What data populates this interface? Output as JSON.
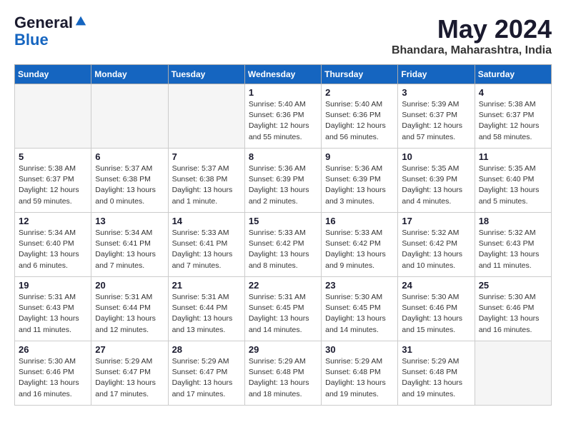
{
  "header": {
    "logo_line1": "General",
    "logo_line2": "Blue",
    "month_year": "May 2024",
    "location": "Bhandara, Maharashtra, India"
  },
  "weekdays": [
    "Sunday",
    "Monday",
    "Tuesday",
    "Wednesday",
    "Thursday",
    "Friday",
    "Saturday"
  ],
  "weeks": [
    [
      {
        "day": "",
        "info": ""
      },
      {
        "day": "",
        "info": ""
      },
      {
        "day": "",
        "info": ""
      },
      {
        "day": "1",
        "info": "Sunrise: 5:40 AM\nSunset: 6:36 PM\nDaylight: 12 hours\nand 55 minutes."
      },
      {
        "day": "2",
        "info": "Sunrise: 5:40 AM\nSunset: 6:36 PM\nDaylight: 12 hours\nand 56 minutes."
      },
      {
        "day": "3",
        "info": "Sunrise: 5:39 AM\nSunset: 6:37 PM\nDaylight: 12 hours\nand 57 minutes."
      },
      {
        "day": "4",
        "info": "Sunrise: 5:38 AM\nSunset: 6:37 PM\nDaylight: 12 hours\nand 58 minutes."
      }
    ],
    [
      {
        "day": "5",
        "info": "Sunrise: 5:38 AM\nSunset: 6:37 PM\nDaylight: 12 hours\nand 59 minutes."
      },
      {
        "day": "6",
        "info": "Sunrise: 5:37 AM\nSunset: 6:38 PM\nDaylight: 13 hours\nand 0 minutes."
      },
      {
        "day": "7",
        "info": "Sunrise: 5:37 AM\nSunset: 6:38 PM\nDaylight: 13 hours\nand 1 minute."
      },
      {
        "day": "8",
        "info": "Sunrise: 5:36 AM\nSunset: 6:39 PM\nDaylight: 13 hours\nand 2 minutes."
      },
      {
        "day": "9",
        "info": "Sunrise: 5:36 AM\nSunset: 6:39 PM\nDaylight: 13 hours\nand 3 minutes."
      },
      {
        "day": "10",
        "info": "Sunrise: 5:35 AM\nSunset: 6:39 PM\nDaylight: 13 hours\nand 4 minutes."
      },
      {
        "day": "11",
        "info": "Sunrise: 5:35 AM\nSunset: 6:40 PM\nDaylight: 13 hours\nand 5 minutes."
      }
    ],
    [
      {
        "day": "12",
        "info": "Sunrise: 5:34 AM\nSunset: 6:40 PM\nDaylight: 13 hours\nand 6 minutes."
      },
      {
        "day": "13",
        "info": "Sunrise: 5:34 AM\nSunset: 6:41 PM\nDaylight: 13 hours\nand 7 minutes."
      },
      {
        "day": "14",
        "info": "Sunrise: 5:33 AM\nSunset: 6:41 PM\nDaylight: 13 hours\nand 7 minutes."
      },
      {
        "day": "15",
        "info": "Sunrise: 5:33 AM\nSunset: 6:42 PM\nDaylight: 13 hours\nand 8 minutes."
      },
      {
        "day": "16",
        "info": "Sunrise: 5:33 AM\nSunset: 6:42 PM\nDaylight: 13 hours\nand 9 minutes."
      },
      {
        "day": "17",
        "info": "Sunrise: 5:32 AM\nSunset: 6:42 PM\nDaylight: 13 hours\nand 10 minutes."
      },
      {
        "day": "18",
        "info": "Sunrise: 5:32 AM\nSunset: 6:43 PM\nDaylight: 13 hours\nand 11 minutes."
      }
    ],
    [
      {
        "day": "19",
        "info": "Sunrise: 5:31 AM\nSunset: 6:43 PM\nDaylight: 13 hours\nand 11 minutes."
      },
      {
        "day": "20",
        "info": "Sunrise: 5:31 AM\nSunset: 6:44 PM\nDaylight: 13 hours\nand 12 minutes."
      },
      {
        "day": "21",
        "info": "Sunrise: 5:31 AM\nSunset: 6:44 PM\nDaylight: 13 hours\nand 13 minutes."
      },
      {
        "day": "22",
        "info": "Sunrise: 5:31 AM\nSunset: 6:45 PM\nDaylight: 13 hours\nand 14 minutes."
      },
      {
        "day": "23",
        "info": "Sunrise: 5:30 AM\nSunset: 6:45 PM\nDaylight: 13 hours\nand 14 minutes."
      },
      {
        "day": "24",
        "info": "Sunrise: 5:30 AM\nSunset: 6:46 PM\nDaylight: 13 hours\nand 15 minutes."
      },
      {
        "day": "25",
        "info": "Sunrise: 5:30 AM\nSunset: 6:46 PM\nDaylight: 13 hours\nand 16 minutes."
      }
    ],
    [
      {
        "day": "26",
        "info": "Sunrise: 5:30 AM\nSunset: 6:46 PM\nDaylight: 13 hours\nand 16 minutes."
      },
      {
        "day": "27",
        "info": "Sunrise: 5:29 AM\nSunset: 6:47 PM\nDaylight: 13 hours\nand 17 minutes."
      },
      {
        "day": "28",
        "info": "Sunrise: 5:29 AM\nSunset: 6:47 PM\nDaylight: 13 hours\nand 17 minutes."
      },
      {
        "day": "29",
        "info": "Sunrise: 5:29 AM\nSunset: 6:48 PM\nDaylight: 13 hours\nand 18 minutes."
      },
      {
        "day": "30",
        "info": "Sunrise: 5:29 AM\nSunset: 6:48 PM\nDaylight: 13 hours\nand 19 minutes."
      },
      {
        "day": "31",
        "info": "Sunrise: 5:29 AM\nSunset: 6:48 PM\nDaylight: 13 hours\nand 19 minutes."
      },
      {
        "day": "",
        "info": ""
      }
    ]
  ]
}
